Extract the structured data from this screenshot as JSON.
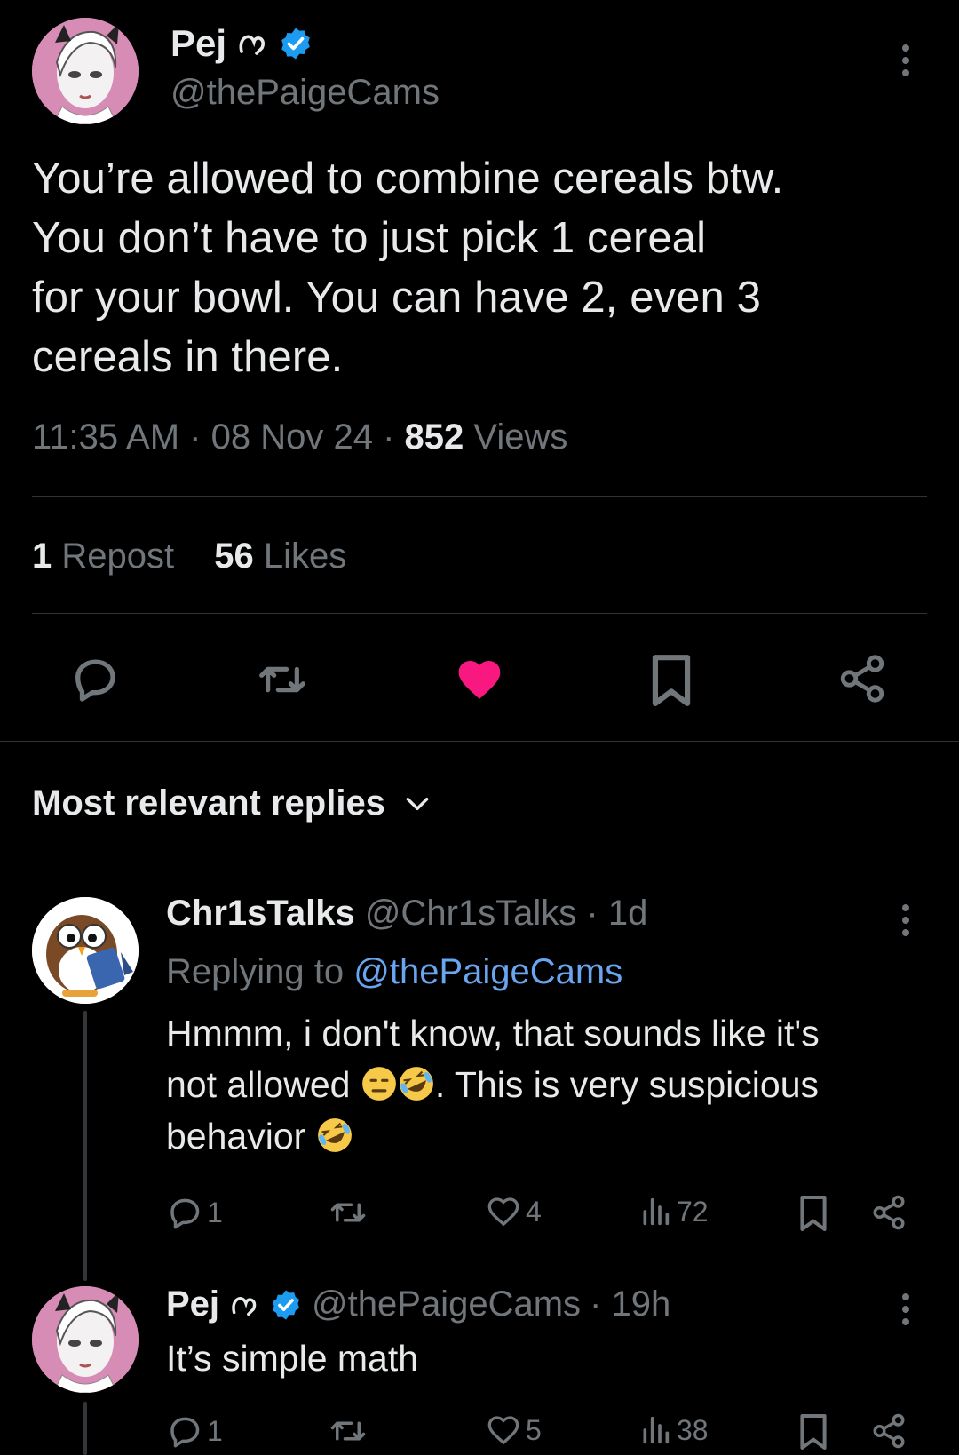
{
  "tweet": {
    "author_name": "Pej",
    "author_handle": "@thePaigeCams",
    "text_lines": [
      "You’re allowed to combine cereals btw.",
      "You don’t have to just pick 1 cereal",
      "for your bowl. You can have 2, even 3",
      "cereals in there."
    ],
    "time": "11:35 AM",
    "date": "08 Nov 24",
    "views_count": "852",
    "views_label": "Views",
    "sep": "·",
    "reposts_count": "1",
    "reposts_label": "Repost",
    "likes_count": "56",
    "likes_label": "Likes"
  },
  "colors": {
    "background": "#000000",
    "text": "#e7e9ea",
    "muted": "#71767b",
    "like": "#f91880",
    "link": "#6aa5f0",
    "verified": "#1d9bf0"
  },
  "section": {
    "title": "Most relevant replies"
  },
  "replies": [
    {
      "name": "Chr1sTalks",
      "handle": "@Chr1sTalks",
      "age": "· 1d",
      "replying_prefix": "Replying to",
      "replying_handle": "@thePaigeCams",
      "text_1": "Hmmm, i don't know, that sounds like it's",
      "text_2a": "not allowed",
      "text_2b": ". This is very suspicious",
      "text_3": "behavior",
      "replies_count": "1",
      "likes_count": "4",
      "views_count": "72"
    },
    {
      "name": "Pej",
      "handle": "@thePaigeCams",
      "age": "· 19h",
      "text": "It’s simple math",
      "replies_count": "1",
      "likes_count": "5",
      "views_count": "38"
    }
  ],
  "icons": [
    "kebab-icon",
    "verified-badge-icon",
    "reply-icon",
    "repost-icon",
    "heart-filled-icon",
    "bookmark-icon",
    "share-icon",
    "chevron-down-icon",
    "heart-outline-icon",
    "views-icon",
    "emoji-expressionless",
    "emoji-rofl"
  ]
}
